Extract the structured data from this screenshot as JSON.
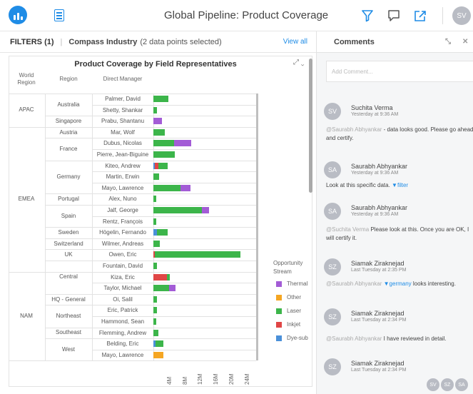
{
  "header": {
    "title": "Global Pipeline: Product Coverage",
    "user_initials": "SV"
  },
  "filters": {
    "label": "FILTERS (1)",
    "industry": "Compass Industry",
    "selection": "(2 data points selected)",
    "view_all": "View all"
  },
  "chart": {
    "title": "Product Coverage by Field Representatives",
    "col_world_region": "World Region",
    "col_region": "Region",
    "col_manager": "Direct Manager",
    "legend_title": "Opportunity Stream",
    "legend": [
      {
        "name": "Thermal",
        "color": "#a35cd6"
      },
      {
        "name": "Other",
        "color": "#f5a623"
      },
      {
        "name": "Laser",
        "color": "#3cb54a"
      },
      {
        "name": "Inkjet",
        "color": "#e04646"
      },
      {
        "name": "Dye-sub",
        "color": "#4a90d9"
      }
    ]
  },
  "chart_data": {
    "type": "bar",
    "orientation": "horizontal",
    "stacked": true,
    "title": "Product Coverage by Field Representatives",
    "x_ticks": [
      "4M",
      "8M",
      "12M",
      "16M",
      "20M",
      "24M"
    ],
    "xlim": [
      0,
      28
    ],
    "x_unit": "M",
    "world_regions": [
      {
        "name": "APAC",
        "rows": [
          0,
          2
        ]
      },
      {
        "name": "EMEA",
        "rows": [
          3,
          15
        ]
      },
      {
        "name": "NAM",
        "rows": [
          16,
          25
        ]
      }
    ],
    "regions": [
      {
        "name": "Australia",
        "rows": [
          0,
          1
        ]
      },
      {
        "name": "Singapore",
        "rows": [
          2,
          2
        ]
      },
      {
        "name": "Austria",
        "rows": [
          3,
          3
        ]
      },
      {
        "name": "France",
        "rows": [
          4,
          5
        ]
      },
      {
        "name": "Germany",
        "rows": [
          6,
          8
        ]
      },
      {
        "name": "Portugal",
        "rows": [
          9,
          9
        ]
      },
      {
        "name": "Spain",
        "rows": [
          10,
          11
        ]
      },
      {
        "name": "Sweden",
        "rows": [
          12,
          12
        ]
      },
      {
        "name": "Switzerland",
        "rows": [
          13,
          13
        ]
      },
      {
        "name": "UK",
        "rows": [
          14,
          14
        ]
      },
      {
        "name": "Central",
        "rows": [
          15,
          17
        ]
      },
      {
        "name": "HQ - General",
        "rows": [
          18,
          18
        ]
      },
      {
        "name": "Northeast",
        "rows": [
          19,
          20
        ]
      },
      {
        "name": "Southeast",
        "rows": [
          21,
          21
        ]
      },
      {
        "name": "West",
        "rows": [
          22,
          23
        ]
      }
    ],
    "rows": [
      {
        "manager": "Palmer, David",
        "Laser": 3.8
      },
      {
        "manager": "Shetty, Shankar",
        "Laser": 1.0
      },
      {
        "manager": "Prabu, Shantanu",
        "Thermal": 2.2
      },
      {
        "manager": "Mar, Wolf",
        "Laser": 3.0
      },
      {
        "manager": "Dubus, Nicolas",
        "Laser": 5.3,
        "Thermal": 4.5
      },
      {
        "manager": "Pierre, Jean-Biguine",
        "Laser": 5.5
      },
      {
        "manager": "Kiteo, Andrew",
        "Dye-sub": 0.4,
        "Inkjet": 0.8,
        "Laser": 2.5
      },
      {
        "manager": "Martin, Erwin",
        "Laser": 1.5
      },
      {
        "manager": "Mayo, Lawrence",
        "Laser": 7.0,
        "Thermal": 2.6
      },
      {
        "manager": "Alex, Nuno",
        "Laser": 0.8
      },
      {
        "manager": "Jalf, George",
        "Laser": 12.5,
        "Thermal": 1.8
      },
      {
        "manager": "Rentz, François",
        "Laser": 0.7
      },
      {
        "manager": "Högelin, Fernando",
        "Dye-sub": 1.0,
        "Laser": 2.6
      },
      {
        "manager": "Wilmer, Andreas",
        "Laser": 1.6
      },
      {
        "manager": "Owen, Eric",
        "Inkjet": 0.3,
        "Laser": 22.0
      },
      {
        "manager": "Fountain, David",
        "Laser": 0.9
      },
      {
        "manager": "Kiza, Eric",
        "Inkjet": 3.5,
        "Laser": 0.7
      },
      {
        "manager": "Taylor, Michael",
        "Laser": 4.0,
        "Thermal": 1.7
      },
      {
        "manager": "Oi, Salil",
        "Laser": 1.0
      },
      {
        "manager": "Eric, Patrick",
        "Laser": 0.9
      },
      {
        "manager": "Hammond, Sean",
        "Laser": 0.8
      },
      {
        "manager": "Flemming, Andrew",
        "Laser": 1.2
      },
      {
        "manager": "Belding, Eric",
        "Laser": 2.0,
        "Dye-sub": 0.5
      },
      {
        "manager": "Mayo, Lawrence",
        "Other": 2.5
      }
    ]
  },
  "comments": {
    "title": "Comments",
    "placeholder": "Add Comment...",
    "items": [
      {
        "initials": "SV",
        "author": "Suchita Verma",
        "time": "Yesterday at 9:36 AM",
        "mention": "@Saurabh Abhyankar",
        "text": " - data looks good. Please go ahead and certify.",
        "link": ""
      },
      {
        "initials": "SA",
        "author": "Saurabh Abhyankar",
        "time": "Yesterday at 9:36 AM",
        "mention": "",
        "text": "Look at this specific data.",
        "link": "▼filter"
      },
      {
        "initials": "SA",
        "author": "Saurabh Abhyankar",
        "time": "Yesterday at 9:36 AM",
        "mention": "@Suchita Verma",
        "text": " Please look at this.  Once you are OK, I will certify it.",
        "link": ""
      },
      {
        "initials": "SZ",
        "author": "Siamak Ziraknejad",
        "time": "Last Tuesday at 2:35 PM",
        "mention": "@Saurabh Abhyankar",
        "text": " looks interesting.",
        "link": "▼germany"
      },
      {
        "initials": "SZ",
        "author": "Siamak Ziraknejad",
        "time": "Last Tuesday at 2:34 PM",
        "mention": "@Saurabh Abhyankar",
        "text": " I have reviewed in detail.",
        "link": ""
      },
      {
        "initials": "SZ",
        "author": "Siamak Ziraknejad",
        "time": "Last Tuesday at 2:34 PM",
        "mention": "",
        "text": "",
        "link": ""
      }
    ],
    "participants": [
      "SV",
      "SZ",
      "SA"
    ]
  }
}
